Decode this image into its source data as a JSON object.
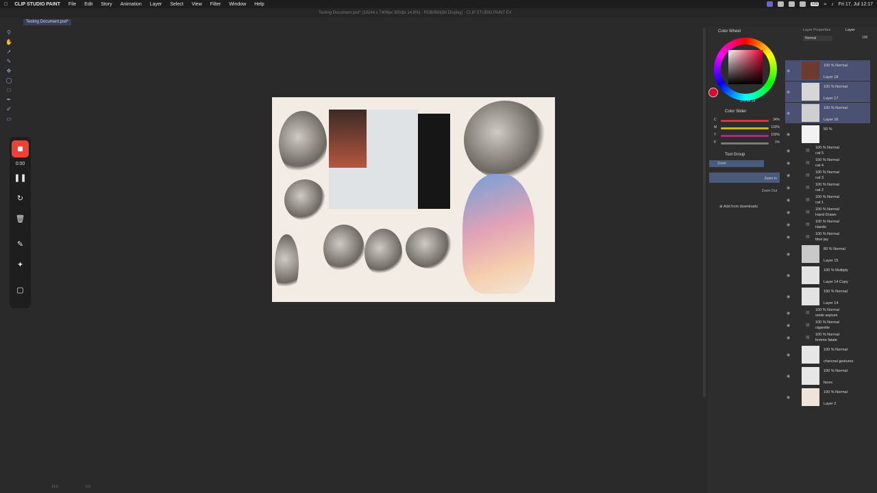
{
  "menubar": {
    "app": "CLIP STUDIO PAINT",
    "items": [
      "File",
      "Edit",
      "Story",
      "Animation",
      "Layer",
      "Select",
      "View",
      "Filter",
      "Window",
      "Help"
    ],
    "clock": "Fri 17. Jul 12:17",
    "lang": "US"
  },
  "window_title": "Testing Document.psd* (10244 x 7408px 300dpi 14.6%) - RGB/8bit(Bit Display) - CLIP STUDIO PAINT EX",
  "document_tab": "Testing Document.psd*",
  "recorder": {
    "time": "0:00"
  },
  "color_wheel": {
    "title": "Color Wheel",
    "h": "172",
    "s": "34",
    "v": "34",
    "main_color": "#e4002e"
  },
  "color_slider": {
    "title": "Color Slider",
    "rows": [
      {
        "label": "C",
        "value": "34%",
        "color": "#d33b3b"
      },
      {
        "label": "M",
        "value": "100%",
        "color": "#c8b234"
      },
      {
        "label": "Y",
        "value": "100%",
        "color": "#b0287a"
      },
      {
        "label": "K",
        "value": "1%",
        "color": "#7a7a7a"
      }
    ]
  },
  "tool_group": {
    "title": "Tool Group",
    "items": [
      "Zoom",
      "Zoom In",
      "Zoom Out"
    ],
    "add": "Add from downloads"
  },
  "layer_panel": {
    "tabs": [
      "Layer Properties",
      "Layer"
    ],
    "blend_mode": "Normal",
    "opacity": "100",
    "layers": [
      {
        "mode": "100 % Normal",
        "name": "Layer 18",
        "selected": true,
        "thumb": "#6d3a2f",
        "type": "big"
      },
      {
        "mode": "100 % Normal",
        "name": "Layer 17",
        "selected": true,
        "thumb": "#d6d6d6",
        "type": "big"
      },
      {
        "mode": "100 % Normal",
        "name": "Layer 16",
        "selected": true,
        "thumb": "#cfcfcf",
        "type": "big"
      },
      {
        "mode": "50 %",
        "name": "",
        "selected": false,
        "thumb": "#f2f2f2",
        "type": "big"
      },
      {
        "mode": "100 % Normal",
        "name": "cat 5",
        "type": "folder"
      },
      {
        "mode": "100 % Normal",
        "name": "cat 4",
        "type": "folder"
      },
      {
        "mode": "100 % Normal",
        "name": "cat 3",
        "type": "folder"
      },
      {
        "mode": "100 % Normal",
        "name": "cat 2",
        "type": "folder"
      },
      {
        "mode": "100 % Normal",
        "name": "cat 1",
        "type": "folder"
      },
      {
        "mode": "100 % Normal",
        "name": "Hand Drawn",
        "type": "folder"
      },
      {
        "mode": "100 % Normal",
        "name": "Hands",
        "type": "folder"
      },
      {
        "mode": "100 % Normal",
        "name": "blue jay",
        "type": "folder"
      },
      {
        "mode": "80 % Normal",
        "name": "Layer 15",
        "thumb": "#c9c9c9",
        "type": "big"
      },
      {
        "mode": "100 % Multiply",
        "name": "Layer 14 Copy",
        "thumb": "#e3e3e3",
        "type": "big"
      },
      {
        "mode": "100 % Normal",
        "name": "Layer 14",
        "thumb": "#e3e3e3",
        "type": "big"
      },
      {
        "mode": "100 % Normal",
        "name": "smile septum",
        "type": "folder"
      },
      {
        "mode": "100 % Normal",
        "name": "cigarette",
        "type": "folder"
      },
      {
        "mode": "100 % Normal",
        "name": "femme fatale",
        "type": "folder"
      },
      {
        "mode": "100 % Normal",
        "name": "charcoal gestures",
        "thumb": "#e6e6e6",
        "type": "big"
      },
      {
        "mode": "100 % Normal",
        "name": "faces",
        "thumb": "#e6e6e6",
        "type": "big"
      },
      {
        "mode": "100 % Normal",
        "name": "Layer 2",
        "thumb": "#efe4d8",
        "type": "big"
      }
    ]
  },
  "status": {
    "zoom": "14.6",
    "angle": "0.0"
  }
}
